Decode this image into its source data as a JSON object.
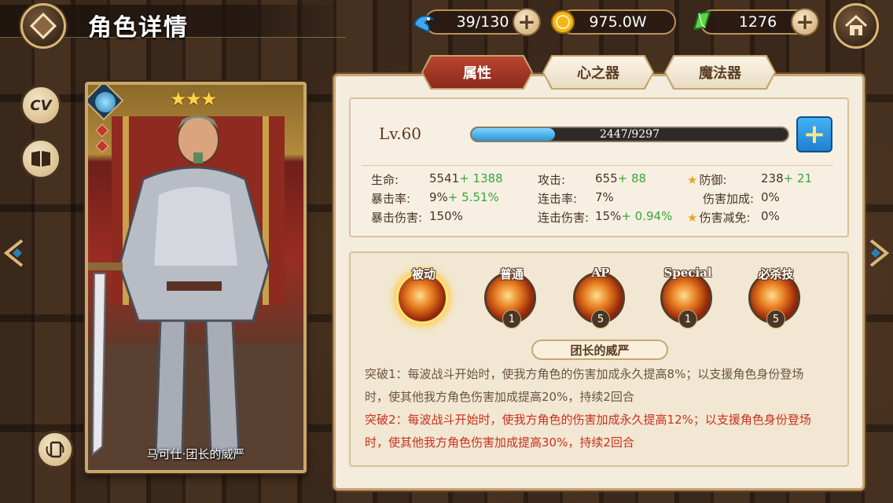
{
  "header": {
    "title": "角色详情"
  },
  "resources": {
    "stamina": "39/130",
    "gold": "975.0W",
    "gems": "1276"
  },
  "side": {
    "cv_label": "CV"
  },
  "card": {
    "name": "马可仕·团长的威严",
    "stars": "★★★"
  },
  "tabs": [
    {
      "label": "属性",
      "active": true
    },
    {
      "label": "心之器",
      "active": false
    },
    {
      "label": "魔法器",
      "active": false
    }
  ],
  "level": {
    "label": "Lv.60",
    "exp_text": "2447/9297",
    "exp_fraction": 0.263
  },
  "stats": {
    "hp": {
      "label": "生命:",
      "value": "5541",
      "bonus": "+ 1388"
    },
    "crit_rate": {
      "label": "暴击率:",
      "value": "9%",
      "bonus": "+ 5.51%"
    },
    "crit_dmg": {
      "label": "暴击伤害:",
      "value": "150%",
      "bonus": ""
    },
    "atk": {
      "label": "攻击:",
      "value": "655",
      "bonus": "+ 88"
    },
    "combo_rate": {
      "label": "连击率:",
      "value": "7%",
      "bonus": ""
    },
    "combo_dmg": {
      "label": "连击伤害:",
      "value": "15%",
      "bonus": "+ 0.94%"
    },
    "def": {
      "label": "防御:",
      "value": "238",
      "bonus": "+ 21"
    },
    "dmg_bonus": {
      "label": "伤害加成:",
      "value": "0%",
      "bonus": ""
    },
    "dmg_reduce": {
      "label": "伤害减免:",
      "value": "0%",
      "bonus": ""
    }
  },
  "skills": [
    {
      "label": "被动",
      "level": "",
      "selected": true
    },
    {
      "label": "普通",
      "level": "1",
      "selected": false
    },
    {
      "label": "AP",
      "level": "5",
      "selected": false
    },
    {
      "label": "Special",
      "level": "1",
      "selected": false
    },
    {
      "label": "必杀技",
      "level": "5",
      "selected": false
    }
  ],
  "skill_detail": {
    "title": "团长的威严",
    "line1": "突破1：每波战斗开始时，使我方角色的伤害加成永久提高8%；以支援角色身份登场",
    "line2": "时，使其他我方角色伤害加成提高20%，持续2回合",
    "line3": "突破2：每波战斗开始时，使我方角色的伤害加成永久提高12%；以支援角色身份登场",
    "line4": "时，使其他我方角色伤害加成提高30%，持续2回合"
  },
  "colors": {
    "accent": "#b9452f",
    "bonus_green": "#3aa63a",
    "highlight_red": "#c8301e",
    "exp_blue": "#2c95d6"
  }
}
